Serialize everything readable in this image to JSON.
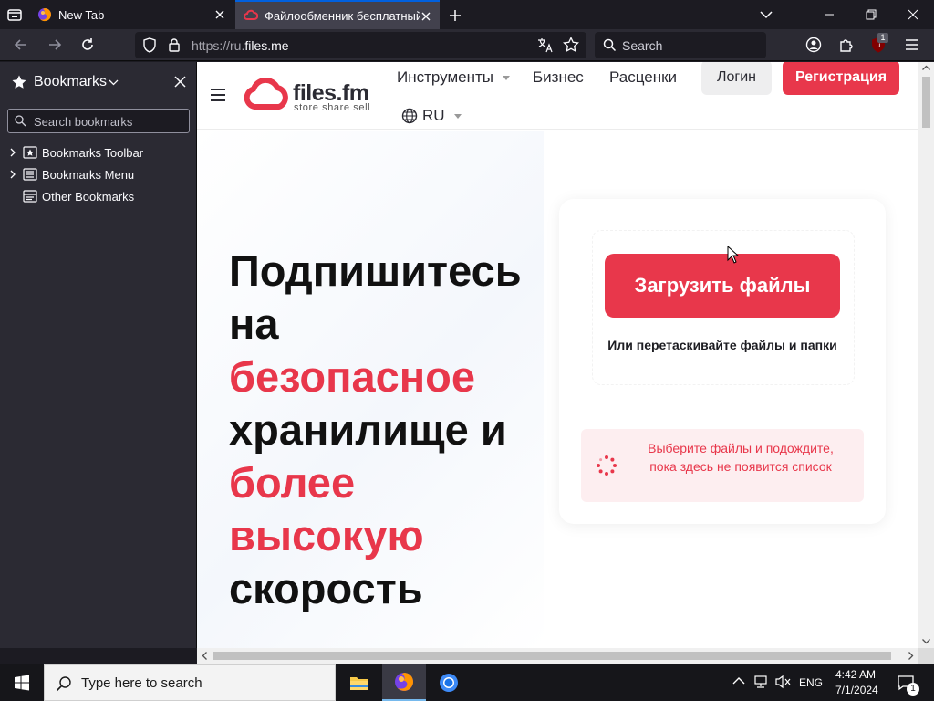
{
  "browser": {
    "tabs": [
      {
        "title": "New Tab",
        "active": false,
        "icon": "firefox-icon"
      },
      {
        "title": "Файлообменник бесплатный с",
        "active": true,
        "icon": "files-fm-cloud-icon"
      }
    ],
    "url": {
      "prefix": "https://ru.",
      "domain": "files.me"
    },
    "search_placeholder": "Search",
    "extension_badge": "1"
  },
  "sidebar": {
    "title": "Bookmarks",
    "search_placeholder": "Search bookmarks",
    "items": [
      {
        "label": "Bookmarks Toolbar",
        "icon": "bookmark-toolbar-icon",
        "expandable": true
      },
      {
        "label": "Bookmarks Menu",
        "icon": "bookmark-menu-icon",
        "expandable": true
      },
      {
        "label": "Other Bookmarks",
        "icon": "other-bookmarks-icon",
        "expandable": false
      }
    ]
  },
  "site": {
    "logo": {
      "name": "files.fm",
      "tagline": "store share sell"
    },
    "nav": {
      "tools": "Инструменты",
      "business": "Бизнес",
      "pricing": "Расценки",
      "language": "RU"
    },
    "login": "Логин",
    "register": "Регистрация",
    "hero": {
      "line1": "Подпишитесь",
      "line2": "на",
      "line3": "безопасное",
      "line4": "хранилище и",
      "line5": "более",
      "line6": "высокую",
      "line7": "скорость"
    },
    "upload": {
      "button": "Загрузить файлы",
      "drag_hint": "Или перетаскивайте файлы и папки",
      "info": "Выберите файлы и подождите, пока здесь не появится список"
    },
    "colors": {
      "accent": "#e8374b"
    }
  },
  "taskbar": {
    "search_placeholder": "Type here to search",
    "language": "ENG",
    "time": "4:42 AM",
    "date": "7/1/2024",
    "notification_count": "1"
  }
}
